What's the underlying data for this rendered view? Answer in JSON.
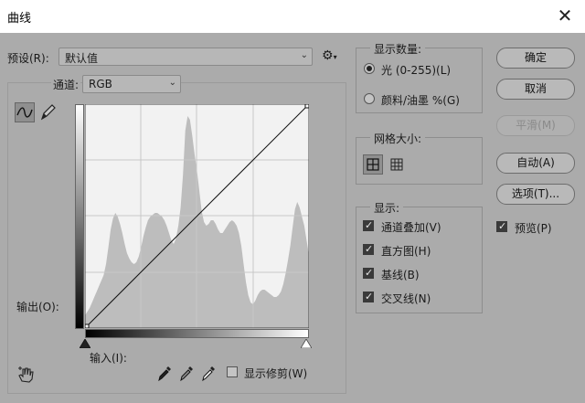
{
  "window": {
    "title": "曲线"
  },
  "preset": {
    "label": "预设(R):",
    "value": "默认值"
  },
  "channel": {
    "label": "通道:",
    "value": "RGB"
  },
  "output_label": "输出(O):",
  "input_label": "输入(I):",
  "show_clipping": {
    "label": "显示修剪(W)",
    "checked": false
  },
  "display_amount": {
    "title": "显示数量:",
    "options": [
      {
        "label": "光 (0-255)(L)",
        "selected": true
      },
      {
        "label": "颜料/油墨 %(G)",
        "selected": false
      }
    ]
  },
  "grid_size": {
    "title": "网格大小:"
  },
  "show": {
    "title": "显示:",
    "items": [
      {
        "label": "通道叠加(V)",
        "checked": true
      },
      {
        "label": "直方图(H)",
        "checked": true
      },
      {
        "label": "基线(B)",
        "checked": true
      },
      {
        "label": "交叉线(N)",
        "checked": true
      }
    ]
  },
  "buttons": {
    "ok": "确定",
    "cancel": "取消",
    "smooth": "平滑(M)",
    "auto": "自动(A)",
    "options": "选项(T)..."
  },
  "preview": {
    "label": "预览(P)",
    "checked": true
  },
  "histogram": [
    14,
    18,
    22,
    28,
    34,
    40,
    46,
    52,
    58,
    70,
    88,
    108,
    120,
    126,
    122,
    114,
    104,
    92,
    82,
    76,
    72,
    70,
    72,
    78,
    88,
    100,
    110,
    118,
    122,
    124,
    126,
    126,
    124,
    122,
    118,
    112,
    104,
    96,
    92,
    98,
    112,
    132,
    168,
    216,
    232,
    228,
    210,
    190,
    172,
    150,
    128,
    116,
    112,
    114,
    118,
    118,
    114,
    108,
    104,
    104,
    108,
    112,
    116,
    118,
    116,
    112,
    104,
    90,
    70,
    50,
    36,
    28,
    26,
    30,
    36,
    40,
    42,
    42,
    40,
    38,
    36,
    34,
    34,
    36,
    40,
    48,
    60,
    74,
    90,
    110,
    130,
    138,
    132,
    122,
    112,
    96,
    80
  ]
}
